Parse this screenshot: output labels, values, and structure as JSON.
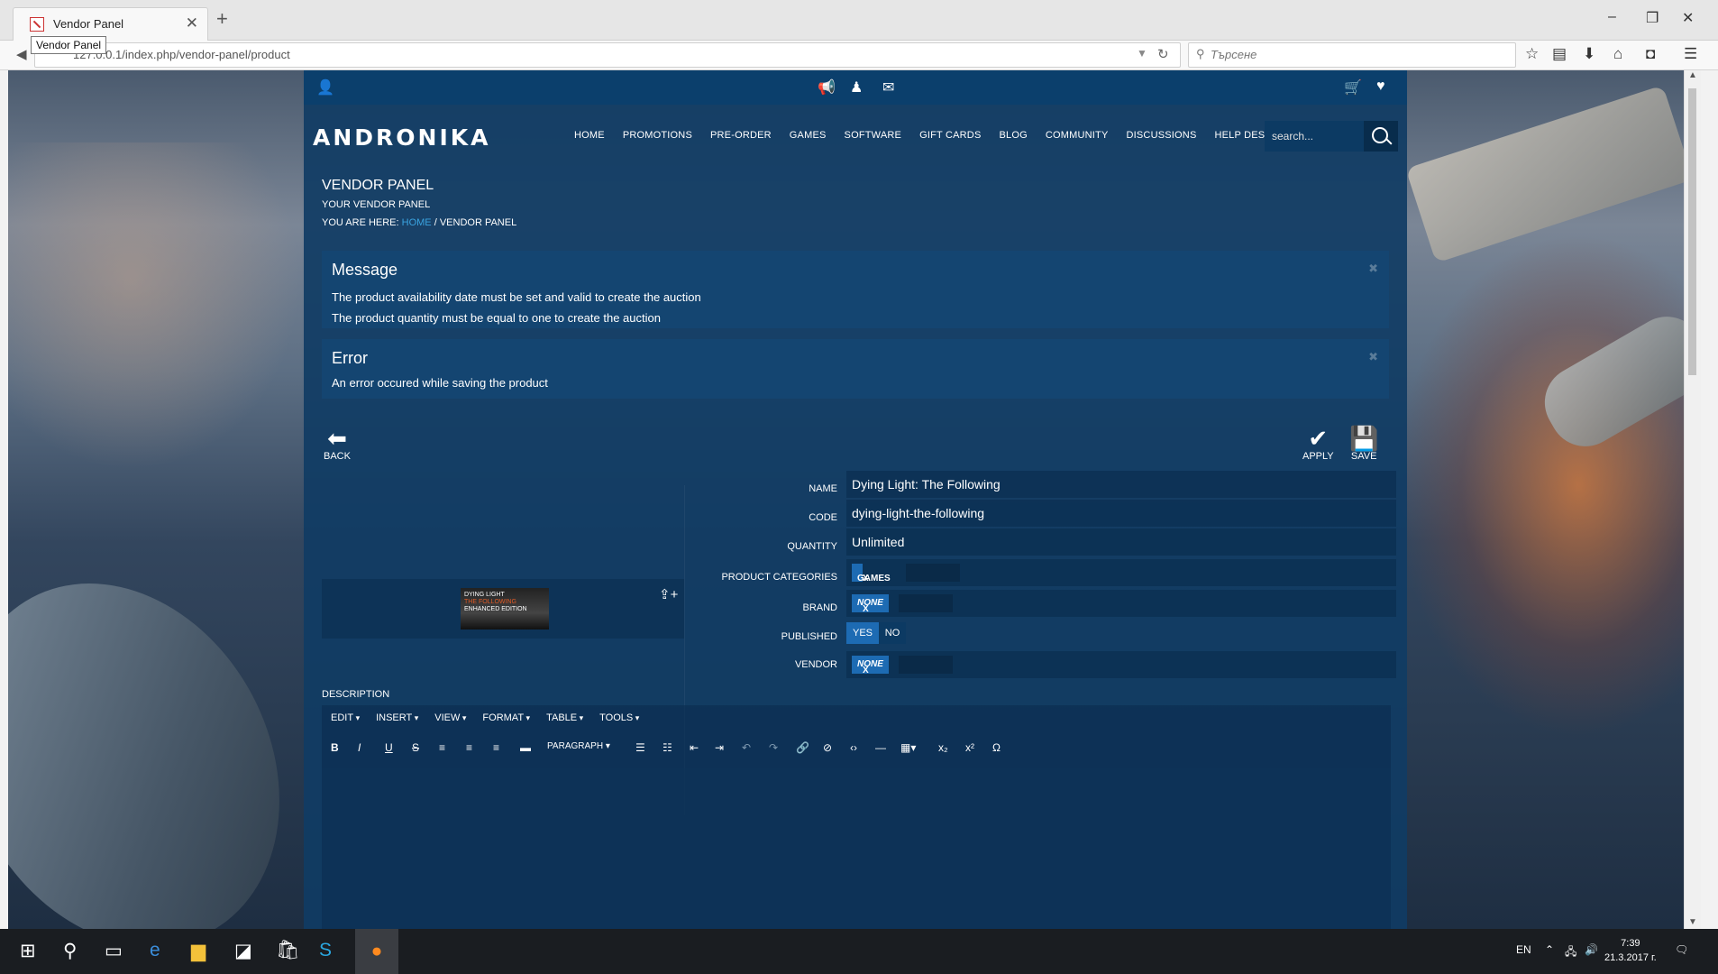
{
  "browser": {
    "tab_title": "Vendor Panel",
    "tooltip": "Vendor Panel",
    "url": "127.0.0.1/index.php/vendor-panel/product",
    "search_placeholder": "Търсене"
  },
  "site": {
    "logo": "ANDRONIKA",
    "menu": [
      "HOME",
      "PROMOTIONS",
      "PRE-ORDER",
      "GAMES",
      "SOFTWARE",
      "GIFT CARDS",
      "BLOG",
      "COMMUNITY",
      "DISCUSSIONS",
      "HELP DESK"
    ],
    "search_placeholder": "search...",
    "page_title": "VENDOR PANEL",
    "page_subtitle": "YOUR VENDOR PANEL",
    "breadcrumb_prefix": "YOU ARE HERE:",
    "breadcrumb_home": "HOME",
    "breadcrumb_sep": "/",
    "breadcrumb_current": "VENDOR PANEL"
  },
  "alerts": {
    "message": {
      "heading": "Message",
      "lines": [
        "The product availability date must be set and valid to create the auction",
        "The product quantity must be equal to one to create the auction"
      ]
    },
    "error": {
      "heading": "Error",
      "lines": [
        "An error occured while saving the product"
      ]
    }
  },
  "toolbar": {
    "back": "BACK",
    "apply": "APPLY",
    "save": "SAVE"
  },
  "image": {
    "thumb_line1": "DYING LIGHT",
    "thumb_line2": "THE FOLLOWING",
    "thumb_line3": "ENHANCED EDITION"
  },
  "form": {
    "name_label": "NAME",
    "name_value": "Dying Light: The Following",
    "code_label": "CODE",
    "code_value": "dying-light-the-following",
    "quantity_label": "QUANTITY",
    "quantity_value": "Unlimited",
    "categories_label": "PRODUCT CATEGORIES",
    "categories_chip": "GAMES",
    "brand_label": "BRAND",
    "brand_chip": "NONE",
    "published_label": "PUBLISHED",
    "published_yes": "YES",
    "published_no": "NO",
    "vendor_label": "VENDOR",
    "vendor_chip": "NONE",
    "chip_remove": "X"
  },
  "editor": {
    "label": "DESCRIPTION",
    "menus": [
      "EDIT",
      "INSERT",
      "VIEW",
      "FORMAT",
      "TABLE",
      "TOOLS"
    ],
    "format_select": "PARAGRAPH"
  },
  "taskbar": {
    "lang": "EN",
    "time": "7:39",
    "date": "21.3.2017 г."
  }
}
